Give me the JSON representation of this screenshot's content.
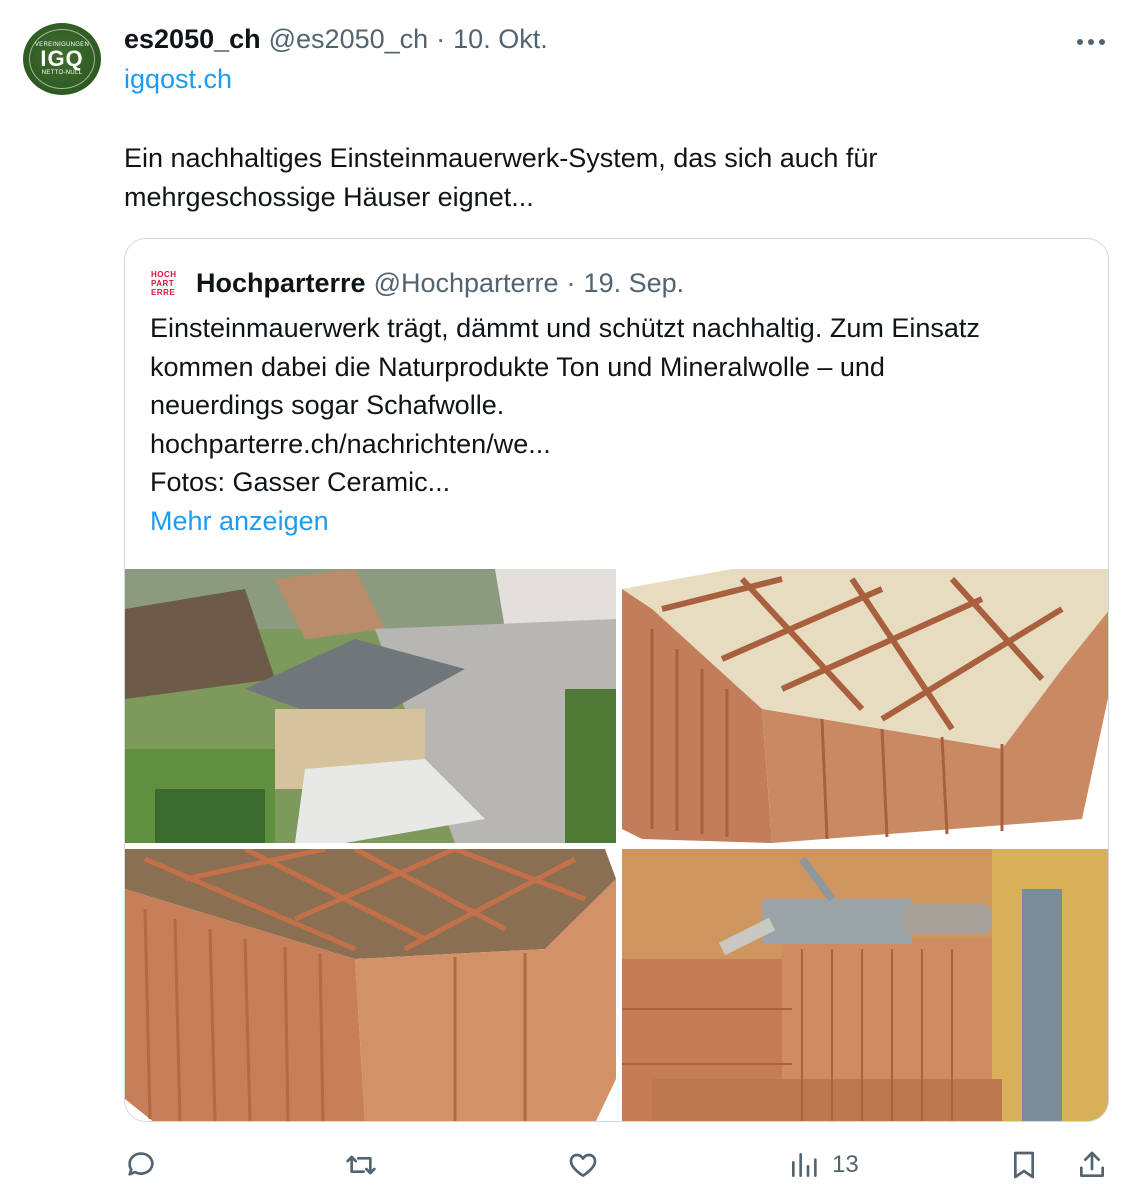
{
  "post": {
    "avatar": {
      "top_text": "VEREINIGUNGEN",
      "main_text": "IGQ",
      "bottom_text": "NETTO-NULL"
    },
    "display_name": "es2050_ch",
    "handle": "@es2050_ch",
    "separator": "·",
    "date": "10. Okt.",
    "more_icon": "more-horizontal-icon",
    "link": "igqost.ch",
    "text_line1": "Ein nachhaltiges Einsteinmauerwerk-System, das sich auch für",
    "text_line2": "mehrgeschossige Häuser eignet..."
  },
  "quote": {
    "logo_lines": [
      "HOCH",
      "PART",
      "ERRE"
    ],
    "display_name": "Hochparterre",
    "handle": "@Hochparterre",
    "separator": "·",
    "date": "19. Sep.",
    "lines": [
      "Einsteinmauerwerk trägt, dämmt und schützt nachhaltig. Zum Einsatz",
      "kommen dabei die Naturprodukte Ton und Mineralwolle – und",
      "neuerdings sogar Schafwolle.",
      "hochparterre.ch/nachrichten/we...",
      "Fotos: Gasser Ceramic..."
    ],
    "show_more": "Mehr anzeigen",
    "images": [
      {
        "name": "aerial-house-photo"
      },
      {
        "name": "brick-mineral-wool-photo"
      },
      {
        "name": "brick-filled-photo"
      },
      {
        "name": "brick-wall-construction-photo"
      }
    ]
  },
  "actions": {
    "reply_icon": "reply-icon",
    "retweet_icon": "retweet-icon",
    "like_icon": "heart-icon",
    "views_icon": "views-chart-icon",
    "views_count": "13",
    "bookmark_icon": "bookmark-icon",
    "share_icon": "share-icon"
  },
  "colors": {
    "accent": "#1d9bf0",
    "secondary_text": "#536471",
    "border": "#cfd9de",
    "avatar_green": "#2d5a22",
    "logo_red": "#d4143a"
  }
}
